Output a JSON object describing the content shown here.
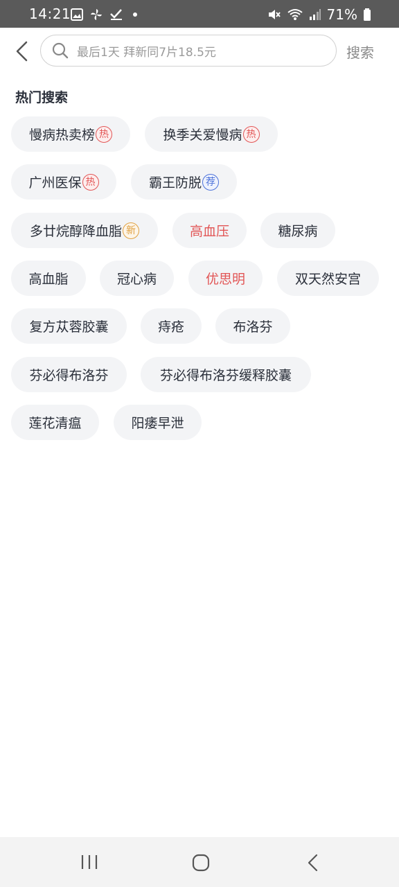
{
  "status_bar": {
    "time": "14:21",
    "battery": "71%",
    "icons": [
      "image-icon",
      "pinwheel-icon",
      "check-icon",
      "dot-icon",
      "mute-icon",
      "wifi-icon",
      "signal-icon",
      "battery-icon"
    ]
  },
  "search": {
    "placeholder": "最后1天 拜新同7片18.5元",
    "button_label": "搜索"
  },
  "hot_search": {
    "title": "热门搜索",
    "tags": [
      {
        "label": "慢病热卖榜",
        "badge": "热",
        "badge_type": "hot",
        "color": "#2a2f3a"
      },
      {
        "label": "换季关爱慢病",
        "badge": "热",
        "badge_type": "hot",
        "color": "#2a2f3a"
      },
      {
        "label": "广州医保",
        "badge": "热",
        "badge_type": "hot",
        "color": "#2a2f3a"
      },
      {
        "label": "霸王防脱",
        "badge": "荐",
        "badge_type": "rec",
        "color": "#2a2f3a"
      },
      {
        "label": "多廿烷醇降血脂",
        "badge": "新",
        "badge_type": "new",
        "color": "#2a2f3a"
      },
      {
        "label": "高血压",
        "badge": "",
        "badge_type": "",
        "color": "#e25555"
      },
      {
        "label": "糖尿病",
        "badge": "",
        "badge_type": "",
        "color": "#2a2f3a"
      },
      {
        "label": "高血脂",
        "badge": "",
        "badge_type": "",
        "color": "#2a2f3a"
      },
      {
        "label": "冠心病",
        "badge": "",
        "badge_type": "",
        "color": "#2a2f3a"
      },
      {
        "label": "优思明",
        "badge": "",
        "badge_type": "",
        "color": "#e25555"
      },
      {
        "label": "双天然安宫",
        "badge": "",
        "badge_type": "",
        "color": "#2a2f3a"
      },
      {
        "label": "复方苁蓉胶囊",
        "badge": "",
        "badge_type": "",
        "color": "#2a2f3a"
      },
      {
        "label": "痔疮",
        "badge": "",
        "badge_type": "",
        "color": "#2a2f3a"
      },
      {
        "label": "布洛芬",
        "badge": "",
        "badge_type": "",
        "color": "#2a2f3a"
      },
      {
        "label": "芬必得布洛芬",
        "badge": "",
        "badge_type": "",
        "color": "#2a2f3a"
      },
      {
        "label": "芬必得布洛芬缓释胶囊",
        "badge": "",
        "badge_type": "",
        "color": "#2a2f3a"
      },
      {
        "label": "莲花清瘟",
        "badge": "",
        "badge_type": "",
        "color": "#2a2f3a"
      },
      {
        "label": "阳痿早泄",
        "badge": "",
        "badge_type": "",
        "color": "#2a2f3a"
      }
    ]
  },
  "nav_bar": {
    "items": [
      "recents-icon",
      "home-icon",
      "back-icon"
    ]
  },
  "colors": {
    "accent_red": "#e25555",
    "badge_blue": "#4c72d9",
    "badge_gold": "#e0a040",
    "tag_bg": "#f3f4f6"
  }
}
